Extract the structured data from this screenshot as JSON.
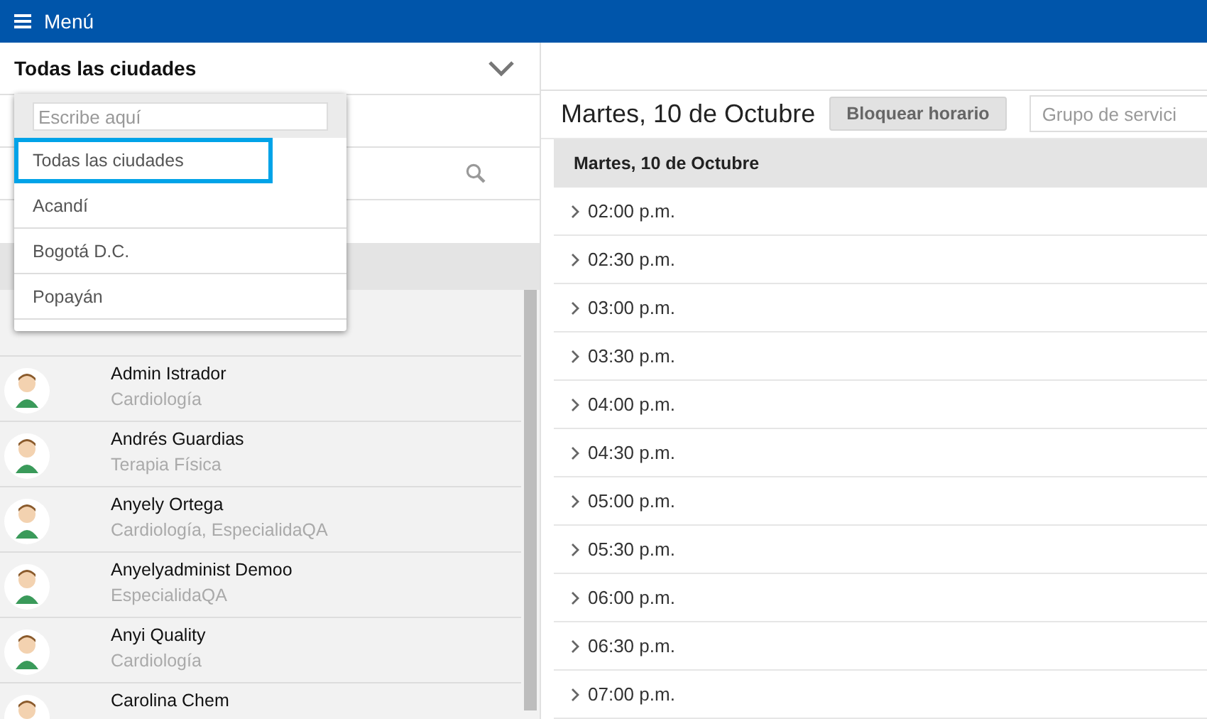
{
  "top_bar": {
    "menu_label": "Menú"
  },
  "city_select": {
    "value": "Todas las ciudades"
  },
  "city_dropdown": {
    "search_placeholder": "Escribe aquí",
    "options": [
      {
        "label": "Todas las ciudades",
        "selected": true
      },
      {
        "label": "Acandí",
        "selected": false
      },
      {
        "label": "Bogotá D.C.",
        "selected": false
      },
      {
        "label": "Popayán",
        "selected": false
      }
    ]
  },
  "doctors": [
    {
      "name": "Admin Istrador",
      "specialty": "Cardiología"
    },
    {
      "name": "Andrés Guardias",
      "specialty": "Terapia Física"
    },
    {
      "name": "Anyely Ortega",
      "specialty": "Cardiología, EspecialidaQA"
    },
    {
      "name": "Anyelyadminist Demoo",
      "specialty": "EspecialidaQA"
    },
    {
      "name": "Anyi Quality",
      "specialty": "Cardiología"
    },
    {
      "name": "Carolina Chem"
    }
  ],
  "schedule": {
    "date_title": "Martes, 10 de Octubre",
    "block_button": "Bloquear horario",
    "service_group_placeholder": "Grupo de servici",
    "day_header": "Martes, 10 de Octubre",
    "slots": [
      "02:00 p.m.",
      "02:30 p.m.",
      "03:00 p.m.",
      "03:30 p.m.",
      "04:00 p.m.",
      "04:30 p.m.",
      "05:00 p.m.",
      "05:30 p.m.",
      "06:00 p.m.",
      "06:30 p.m.",
      "07:00 p.m."
    ]
  }
}
